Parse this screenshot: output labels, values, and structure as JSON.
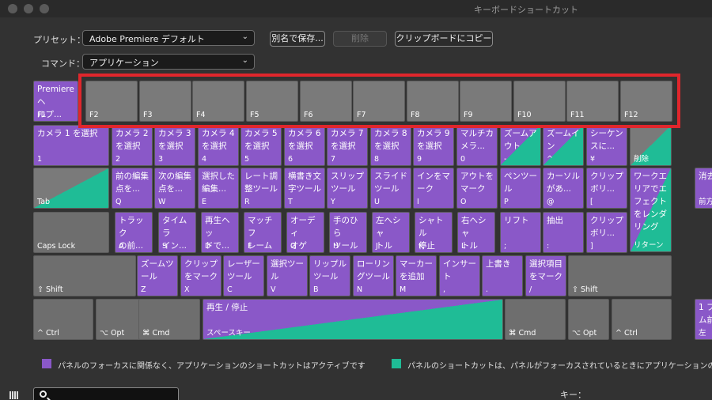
{
  "window": {
    "title": "キーボードショートカット"
  },
  "preset": {
    "label": "プリセット：",
    "value": "Adobe Premiere デフォルト"
  },
  "command": {
    "label": "コマンド：",
    "value": "アプリケーション"
  },
  "buttons": {
    "save_as": "別名で保存...",
    "delete": "削除",
    "copy": "クリップボードにコピー"
  },
  "colors": {
    "app_shortcut": "#8a58c8",
    "panel_shortcut": "#1fbc96",
    "unassigned": "#7a7a7a",
    "highlight": "#e0262c"
  },
  "legend": {
    "app": "パネルのフォーカスに関係なく、アプリケーションのショートカットはアクティブです",
    "panel": "パネルのショートカットは、パネルがフォーカスされているときにアプリケーションの"
  },
  "search": {
    "placeholder": ""
  },
  "key_label": "キー：",
  "rows": [
    [
      {
        "cap": "F1",
        "cmd": "Premiere ヘ\nルプ...",
        "type": "purple"
      },
      {
        "cap": "F2"
      },
      {
        "cap": "F3"
      },
      {
        "cap": "F4"
      },
      {
        "cap": "F5"
      },
      {
        "cap": "F6"
      },
      {
        "cap": "F7"
      },
      {
        "cap": "F8"
      },
      {
        "cap": "F9"
      },
      {
        "cap": "F10"
      },
      {
        "cap": "F11"
      },
      {
        "cap": "F12"
      }
    ],
    [
      {
        "cap": "1",
        "cmd": "カメラ 1 を選択",
        "type": "purple"
      },
      {
        "cap": "2",
        "cmd": "カメラ 2\nを選択",
        "type": "purple"
      },
      {
        "cap": "3",
        "cmd": "カメラ 3\nを選択",
        "type": "purple"
      },
      {
        "cap": "4",
        "cmd": "カメラ 4\nを選択",
        "type": "purple"
      },
      {
        "cap": "5",
        "cmd": "カメラ 5\nを選択",
        "type": "purple"
      },
      {
        "cap": "6",
        "cmd": "カメラ 6\nを選択",
        "type": "purple"
      },
      {
        "cap": "7",
        "cmd": "カメラ 7\nを選択",
        "type": "purple"
      },
      {
        "cap": "8",
        "cmd": "カメラ 8\nを選択",
        "type": "purple"
      },
      {
        "cap": "9",
        "cmd": "カメラ 9\nを選択",
        "type": "purple"
      },
      {
        "cap": "0",
        "cmd": "マルチカ\nメラ...",
        "type": "purple"
      },
      {
        "cap": "-",
        "cmd": "ズームア\nウト",
        "type": "split"
      },
      {
        "cap": "^",
        "cmd": "ズームイ\nン",
        "type": "split"
      },
      {
        "cap": "¥",
        "cmd": "シーケン\nスに...",
        "type": "purple"
      },
      {
        "cap": "削除",
        "cmd": "",
        "type": "split-gray"
      }
    ],
    [
      {
        "cap": "Tab",
        "cmd": "",
        "type": "split-gray"
      },
      {
        "cap": "Q",
        "cmd": "前の編集\n点を...",
        "type": "purple"
      },
      {
        "cap": "W",
        "cmd": "次の編集\n点を...",
        "type": "purple"
      },
      {
        "cap": "E",
        "cmd": "選択した\n編集...",
        "type": "purple"
      },
      {
        "cap": "R",
        "cmd": "レート調\n整ツール",
        "type": "purple"
      },
      {
        "cap": "T",
        "cmd": "横書き文\n字ツール",
        "type": "purple"
      },
      {
        "cap": "Y",
        "cmd": "スリップ\nツール",
        "type": "purple"
      },
      {
        "cap": "U",
        "cmd": "スライド\nツール",
        "type": "purple"
      },
      {
        "cap": "I",
        "cmd": "インをマ\nーク",
        "type": "purple"
      },
      {
        "cap": "O",
        "cmd": "アウトを\nマーク",
        "type": "purple"
      },
      {
        "cap": "P",
        "cmd": "ペンツー\nル",
        "type": "purple"
      },
      {
        "cap": "@",
        "cmd": "カーソル\nがあ...",
        "type": "purple"
      },
      {
        "cap": "[",
        "cmd": "クリップ\nボリ...",
        "type": "purple"
      },
      {
        "cap": "リターン",
        "cmd": "ワークエ\nリアでエ\nフェクト\nをレンダ\nリング",
        "type": "split-tall"
      }
    ],
    [
      {
        "cap": "Caps Lock",
        "cmd": "",
        "type": "empty"
      },
      {
        "cap": "A",
        "cmd": "トラック\nの前...",
        "type": "purple"
      },
      {
        "cap": "S",
        "cmd": "タイムラ\nイン...",
        "type": "purple"
      },
      {
        "cap": "D",
        "cmd": "再生ヘッ\nドで...",
        "type": "purple"
      },
      {
        "cap": "F",
        "cmd": "マッチフ\nレーム",
        "type": "purple"
      },
      {
        "cap": "G",
        "cmd": "オーディ\nオゲイ...",
        "type": "purple"
      },
      {
        "cap": "H",
        "cmd": "手のひら\nツール",
        "type": "purple"
      },
      {
        "cap": "J",
        "cmd": "左へシャ\nトル",
        "type": "purple"
      },
      {
        "cap": "K",
        "cmd": "シャトル\n停止",
        "type": "purple"
      },
      {
        "cap": "L",
        "cmd": "右へシャ\nトル",
        "type": "purple"
      },
      {
        "cap": ";",
        "cmd": "リフト",
        "type": "purple"
      },
      {
        "cap": ":",
        "cmd": "抽出",
        "type": "purple"
      },
      {
        "cap": "]",
        "cmd": "クリップ\nボリ...",
        "type": "purple"
      }
    ],
    [
      {
        "cap": "⇧ Shift",
        "cmd": "",
        "type": "empty"
      },
      {
        "cap": "Z",
        "cmd": "ズームツ\nール",
        "type": "purple"
      },
      {
        "cap": "X",
        "cmd": "クリップ\nをマーク",
        "type": "purple"
      },
      {
        "cap": "C",
        "cmd": "レーザー\nツール",
        "type": "purple"
      },
      {
        "cap": "V",
        "cmd": "選択ツー\nル",
        "type": "purple"
      },
      {
        "cap": "B",
        "cmd": "リップル\nツール",
        "type": "purple"
      },
      {
        "cap": "N",
        "cmd": "ローリン\nグツール",
        "type": "purple"
      },
      {
        "cap": "M",
        "cmd": "マーカー\nを追加",
        "type": "purple"
      },
      {
        "cap": ",",
        "cmd": "インサー\nト",
        "type": "purple"
      },
      {
        "cap": ".",
        "cmd": "上書き",
        "type": "purple"
      },
      {
        "cap": "/",
        "cmd": "選択項目\nをマーク",
        "type": "purple"
      },
      {
        "cap": "⇧ Shift",
        "cmd": "",
        "type": "empty"
      }
    ],
    [
      {
        "cap": "^ Ctrl",
        "cmd": "",
        "type": "empty"
      },
      {
        "cap": "⌥ Opt",
        "cmd": "",
        "type": "empty"
      },
      {
        "cap": "⌘ Cmd",
        "cmd": "",
        "type": "empty"
      },
      {
        "cap": "スペースキー",
        "cmd": "再生 / 停止",
        "type": "split-wide"
      },
      {
        "cap": "⌘ Cmd",
        "cmd": "",
        "type": "empty"
      },
      {
        "cap": "⌥ Opt",
        "cmd": "",
        "type": "empty"
      },
      {
        "cap": "^ Ctrl",
        "cmd": "",
        "type": "empty"
      }
    ]
  ],
  "side_keys": [
    {
      "cap": "前方",
      "cmd": "消去"
    },
    {
      "cap": "左",
      "cmd": "1 フ\nム前"
    }
  ]
}
